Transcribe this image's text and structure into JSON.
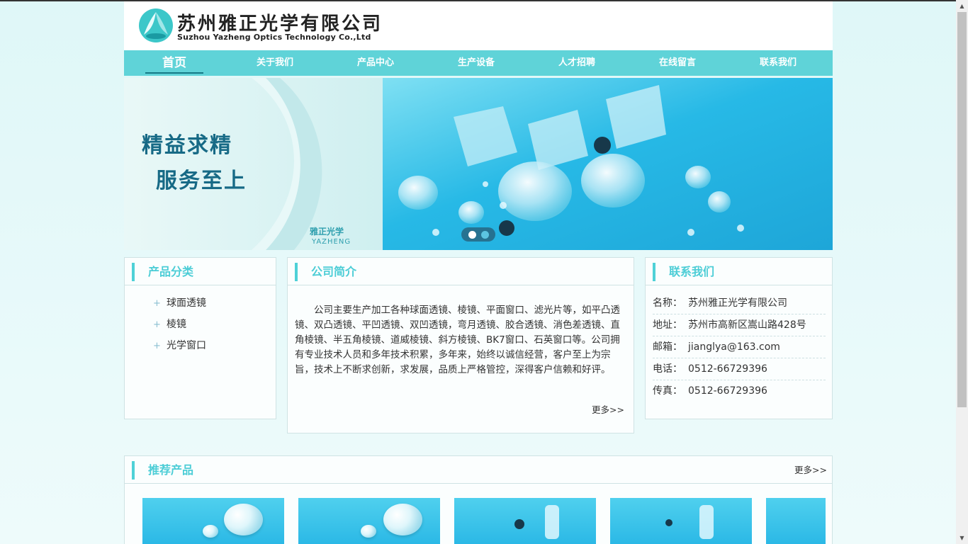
{
  "header": {
    "company_cn": "苏州雅正光学有限公司",
    "company_en": "Suzhou Yazheng Optics Technology Co.,Ltd"
  },
  "nav": {
    "items": [
      "首页",
      "关于我们",
      "产品中心",
      "生产设备",
      "人才招聘",
      "在线留言",
      "联系我们"
    ],
    "active_index": 0
  },
  "banner": {
    "slogan_line1": "精益求精",
    "slogan_line2": "服务至上",
    "brand_cn": "雅正光学",
    "brand_en": "YAZHENG",
    "slides": 2,
    "active_slide": 0
  },
  "categories": {
    "title": "产品分类",
    "items": [
      "球面透镜",
      "棱镜",
      "光学窗口"
    ]
  },
  "intro": {
    "title": "公司简介",
    "text": "公司主要生产加工各种球面透镜、棱镜、平面窗口、滤光片等，如平凸透镜、双凸透镜、平凹透镜、双凹透镜，弯月透镜、胶合透镜、消色差透镜、直角棱镜、半五角棱镜、道威棱镜、斜方棱镜、BK7窗口、石英窗口等。公司拥有专业技术人员和多年技术积累，多年来，始终以诚信经营，客户至上为宗旨，技术上不断求创新，求发展，品质上严格管控，深得客户信赖和好评。",
    "more": "更多>>"
  },
  "contact": {
    "title": "联系我们",
    "rows": [
      {
        "k": "名称：",
        "v": "苏州雅正光学有限公司"
      },
      {
        "k": "地址：",
        "v": "苏州市高新区嵩山路428号"
      },
      {
        "k": "邮箱：",
        "v": "jianglya@163.com"
      },
      {
        "k": "电话：",
        "v": "0512-66729396"
      },
      {
        "k": "传真：",
        "v": "0512-66729396"
      }
    ]
  },
  "recommend": {
    "title": "推荐产品",
    "more": "更多>>"
  },
  "colors": {
    "accent": "#5fd3d8",
    "title": "#4ccdd6",
    "banner_text": "#176a86"
  }
}
